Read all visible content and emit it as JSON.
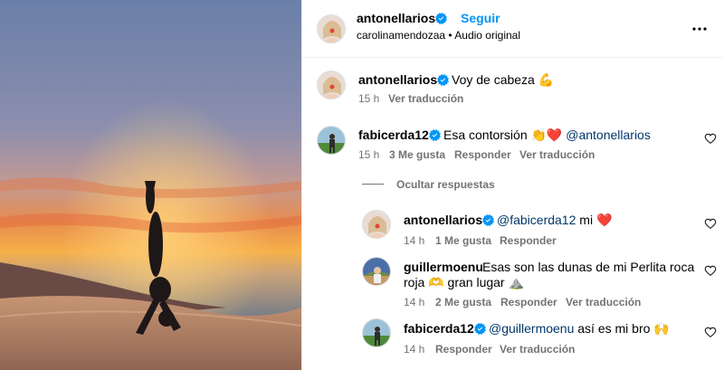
{
  "post": {
    "author": "antonellarios",
    "follow_label": "Seguir",
    "sub_user": "carolinamendozaa",
    "sub_sep": " • ",
    "audio": "Audio original",
    "more_label": "···"
  },
  "caption": {
    "user": "antonellarios",
    "text": "Voy de cabeza 💪",
    "time": "15 h",
    "translate": "Ver traducción"
  },
  "comment1": {
    "user": "fabicerda12",
    "text": "Esa contorsión 👏❤️ ",
    "mention": "@antonellarios",
    "time": "15 h",
    "likes": "3 Me gusta",
    "reply": "Responder",
    "translate": "Ver traducción",
    "hide_replies": "Ocultar respuestas"
  },
  "replies": [
    {
      "user": "antonellarios",
      "mention": "@fabicerda12",
      "text": " mi ❤️",
      "time": "14 h",
      "likes": "1 Me gusta",
      "reply": "Responder"
    },
    {
      "user": "guillermoenu",
      "text_line1": "Esas son las dunas de mi Perlita roca",
      "text_line2": "roja 🫶 gran lugar ⛰️",
      "time": "14 h",
      "likes": "2 Me gusta",
      "reply": "Responder",
      "translate": "Ver traducción"
    },
    {
      "user": "fabicerda12",
      "mention": "@guillermoenu",
      "text": " así es mi bro 🙌",
      "time": "14 h",
      "reply": "Responder",
      "translate": "Ver traducción"
    }
  ],
  "colors": {
    "accent": "#0095f6",
    "mention": "#00376b",
    "secondary_text": "#737373",
    "verified": "#0095f6"
  },
  "icons": [
    "verified-badge-icon",
    "more-options-icon",
    "heart-icon"
  ]
}
